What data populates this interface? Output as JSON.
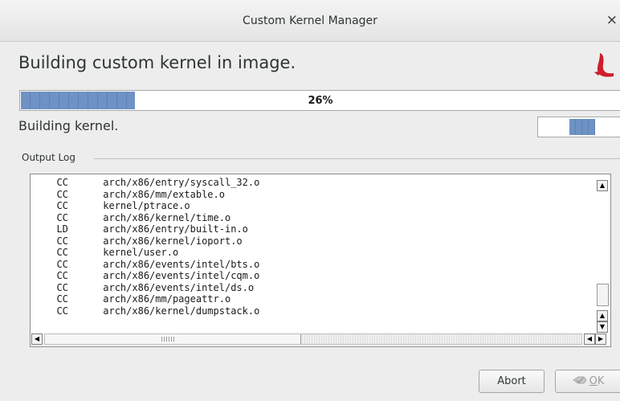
{
  "window": {
    "title": "Custom Kernel Manager",
    "close_glyph": "×"
  },
  "heading": "Building custom kernel in image.",
  "logo_icon": "red-hat-swoosh-logo",
  "progress": {
    "fraction": 0.26,
    "label": "26%"
  },
  "status": "Building kernel.",
  "log": {
    "frame_label": "Output Log",
    "lines": [
      "  CC      arch/x86/entry/syscall_32.o",
      "  CC      arch/x86/mm/extable.o",
      "  CC      kernel/ptrace.o",
      "  CC      arch/x86/kernel/time.o",
      "  LD      arch/x86/entry/built-in.o",
      "  CC      arch/x86/kernel/ioport.o",
      "  CC      kernel/user.o",
      "  CC      arch/x86/events/intel/bts.o",
      "  CC      arch/x86/events/intel/cqm.o",
      "  CC      arch/x86/events/intel/ds.o",
      "  CC      arch/x86/mm/pageattr.o",
      "  CC      arch/x86/kernel/dumpstack.o"
    ]
  },
  "buttons": {
    "abort": "Abort",
    "ok_underlined": "O",
    "ok_rest": "K"
  },
  "colors": {
    "accent_progress": "#6f92c5",
    "logo_red": "#cc1f2b"
  }
}
